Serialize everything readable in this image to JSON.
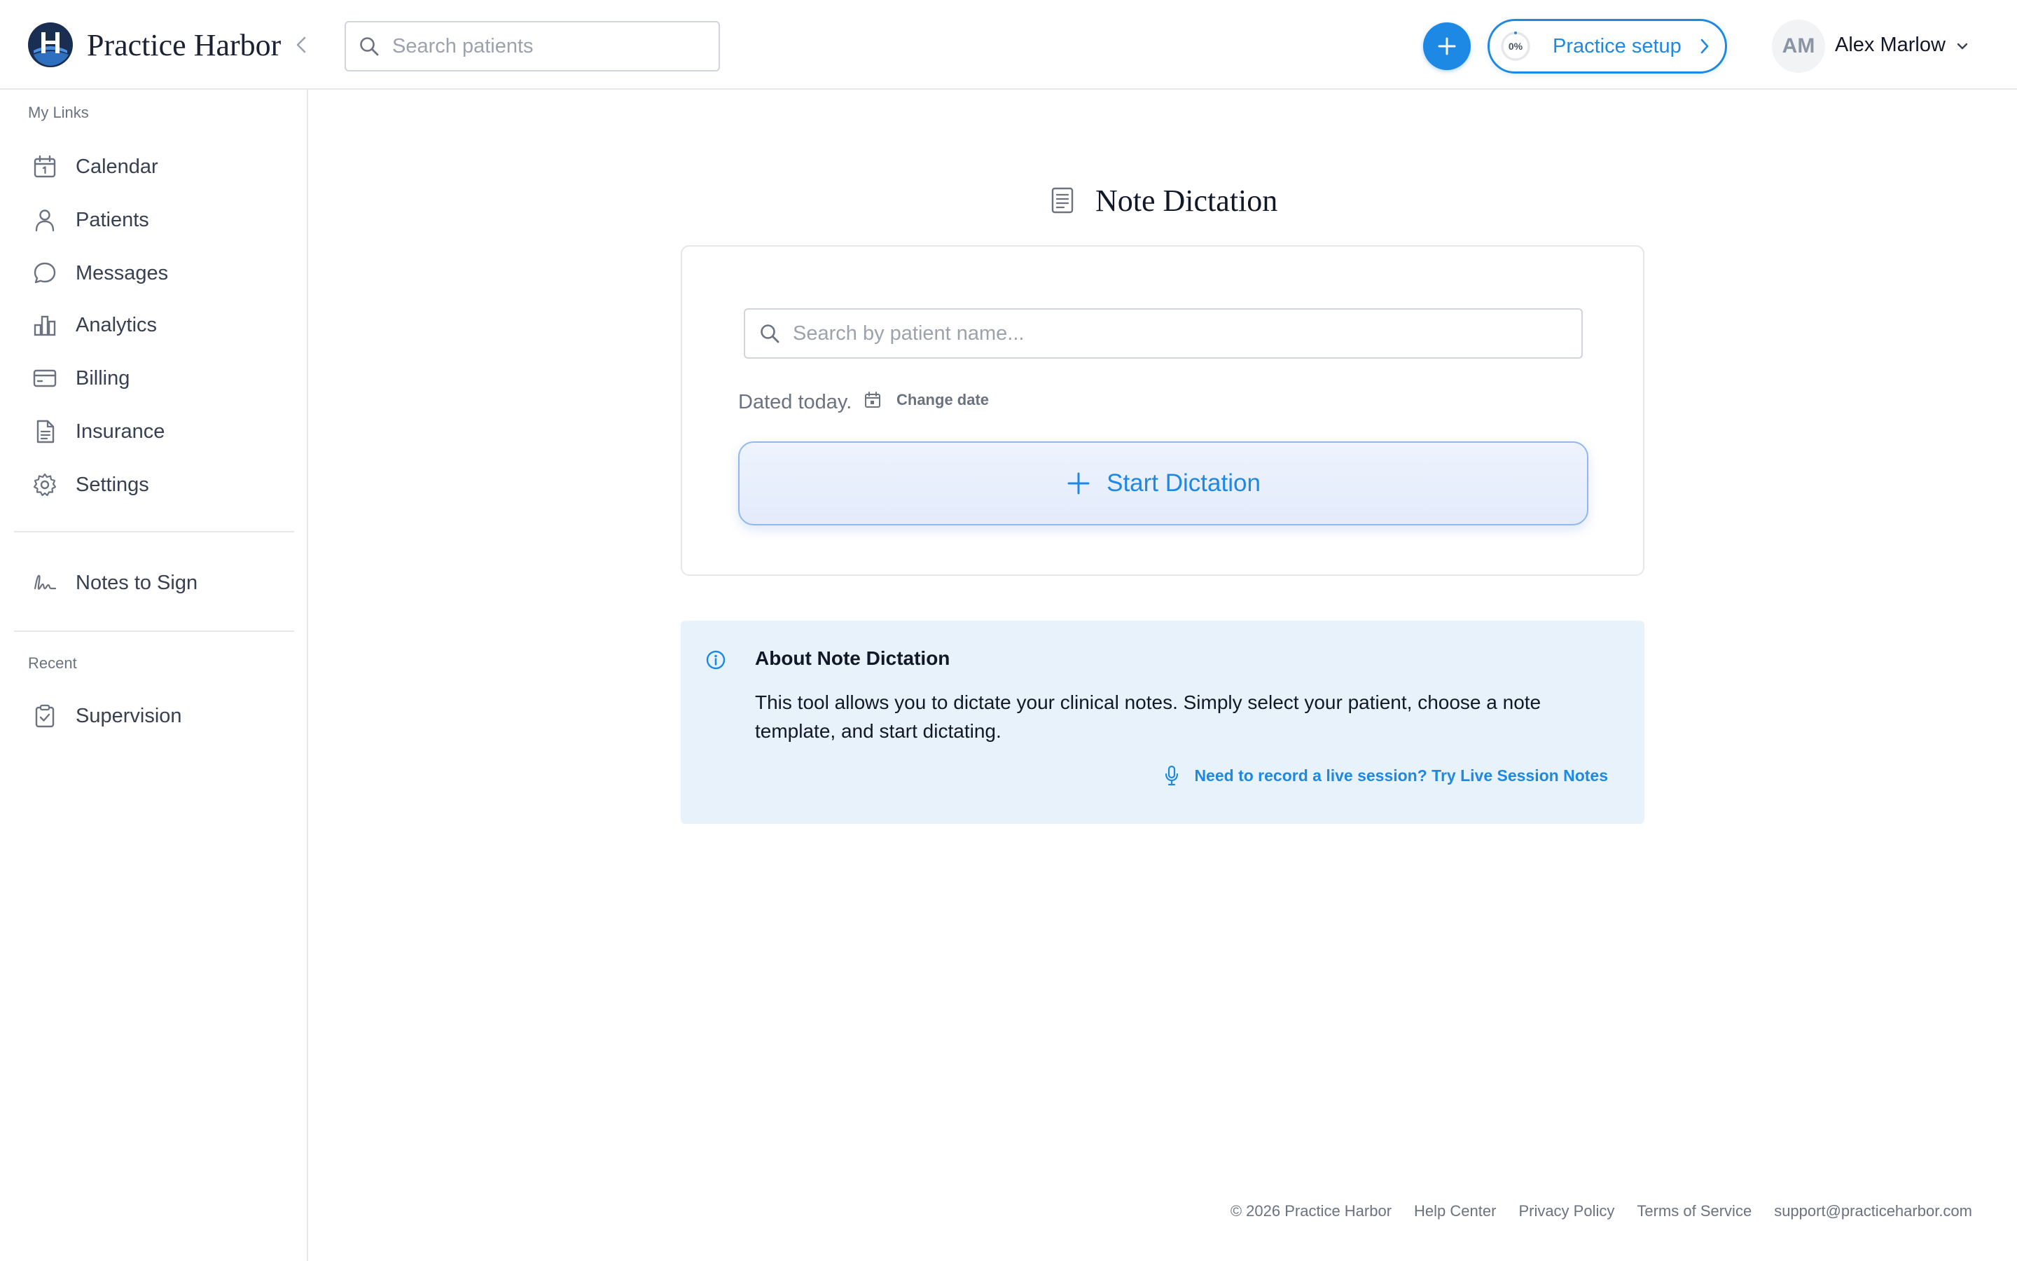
{
  "header": {
    "brand": "Practice Harbor",
    "search_placeholder": "Search patients",
    "setup_progress": "0%",
    "setup_label": "Practice setup",
    "user_initials": "AM",
    "user_name": "Alex Marlow"
  },
  "sidebar": {
    "my_links_label": "My Links",
    "items": [
      {
        "label": "Calendar",
        "icon": "calendar-icon"
      },
      {
        "label": "Patients",
        "icon": "person-icon"
      },
      {
        "label": "Messages",
        "icon": "chat-bubble-icon"
      },
      {
        "label": "Analytics",
        "icon": "bar-chart-icon"
      },
      {
        "label": "Billing",
        "icon": "credit-card-icon"
      },
      {
        "label": "Insurance",
        "icon": "document-icon"
      },
      {
        "label": "Settings",
        "icon": "gear-icon"
      }
    ],
    "notes_to_sign": {
      "label": "Notes to Sign",
      "icon": "signature-icon"
    },
    "recent_label": "Recent",
    "recent_items": [
      {
        "label": "Supervision",
        "icon": "clipboard-check-icon"
      }
    ]
  },
  "main": {
    "title": "Note Dictation",
    "patient_search_placeholder": "Search by patient name...",
    "dated_text": "Dated today.",
    "change_date_label": "Change date",
    "start_button_label": "Start Dictation",
    "info": {
      "title": "About Note Dictation",
      "body": "This tool allows you to dictate your clinical notes. Simply select your patient, choose a note template, and start dictating.",
      "link_label": "Need to record a live session? Try Live Session Notes"
    }
  },
  "footer": {
    "copyright": "© 2026 Practice Harbor",
    "help": "Help Center",
    "privacy": "Privacy Policy",
    "terms": "Terms of Service",
    "email": "support@practiceharbor.com"
  },
  "colors": {
    "accent": "#1e88e5",
    "brand_navy": "#1a2e52",
    "info_bg": "#e8f2fb",
    "text_muted": "#6b7280"
  }
}
